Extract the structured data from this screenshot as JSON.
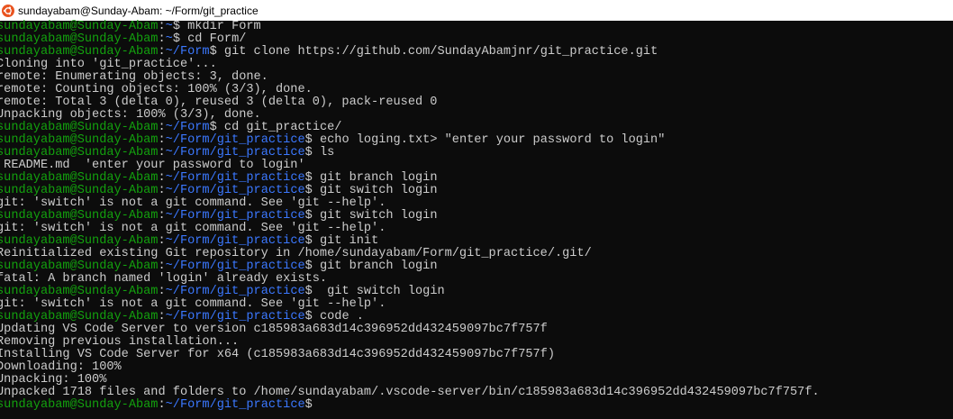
{
  "titlebar": {
    "title": "sundayabam@Sunday-Abam: ~/Form/git_practice",
    "icon": "ubuntu-icon"
  },
  "colors": {
    "background": "#0c0c0c",
    "prompt_user": "#13a10e",
    "prompt_path": "#3b78ff",
    "text": "#cccccc"
  },
  "terminal": {
    "lines": [
      {
        "type": "prompt",
        "user": "sundayabam@Sunday-Abam",
        "path": "~",
        "cmd": " mkdir Form"
      },
      {
        "type": "prompt",
        "user": "sundayabam@Sunday-Abam",
        "path": "~",
        "cmd": " cd Form/"
      },
      {
        "type": "prompt",
        "user": "sundayabam@Sunday-Abam",
        "path": "~/Form",
        "cmd": " git clone https://github.com/SundayAbamjnr/git_practice.git"
      },
      {
        "type": "output",
        "text": "Cloning into 'git_practice'..."
      },
      {
        "type": "output",
        "text": "remote: Enumerating objects: 3, done."
      },
      {
        "type": "output",
        "text": "remote: Counting objects: 100% (3/3), done."
      },
      {
        "type": "output",
        "text": "remote: Total 3 (delta 0), reused 3 (delta 0), pack-reused 0"
      },
      {
        "type": "output",
        "text": "Unpacking objects: 100% (3/3), done."
      },
      {
        "type": "prompt",
        "user": "sundayabam@Sunday-Abam",
        "path": "~/Form",
        "cmd": " cd git_practice/"
      },
      {
        "type": "prompt",
        "user": "sundayabam@Sunday-Abam",
        "path": "~/Form/git_practice",
        "cmd": " echo loging.txt> \"enter your password to login\""
      },
      {
        "type": "prompt",
        "user": "sundayabam@Sunday-Abam",
        "path": "~/Form/git_practice",
        "cmd": " ls"
      },
      {
        "type": "output",
        "text": " README.md  'enter your password to login'"
      },
      {
        "type": "prompt",
        "user": "sundayabam@Sunday-Abam",
        "path": "~/Form/git_practice",
        "cmd": " git branch login"
      },
      {
        "type": "prompt",
        "user": "sundayabam@Sunday-Abam",
        "path": "~/Form/git_practice",
        "cmd": " git switch login"
      },
      {
        "type": "output",
        "text": "git: 'switch' is not a git command. See 'git --help'."
      },
      {
        "type": "prompt",
        "user": "sundayabam@Sunday-Abam",
        "path": "~/Form/git_practice",
        "cmd": " git switch login"
      },
      {
        "type": "output",
        "text": "git: 'switch' is not a git command. See 'git --help'."
      },
      {
        "type": "prompt",
        "user": "sundayabam@Sunday-Abam",
        "path": "~/Form/git_practice",
        "cmd": " git init"
      },
      {
        "type": "output",
        "text": "Reinitialized existing Git repository in /home/sundayabam/Form/git_practice/.git/"
      },
      {
        "type": "prompt",
        "user": "sundayabam@Sunday-Abam",
        "path": "~/Form/git_practice",
        "cmd": " git branch login"
      },
      {
        "type": "output",
        "text": "fatal: A branch named 'login' already exists."
      },
      {
        "type": "prompt",
        "user": "sundayabam@Sunday-Abam",
        "path": "~/Form/git_practice",
        "cmd": "  git switch login"
      },
      {
        "type": "output",
        "text": "git: 'switch' is not a git command. See 'git --help'."
      },
      {
        "type": "prompt",
        "user": "sundayabam@Sunday-Abam",
        "path": "~/Form/git_practice",
        "cmd": " code ."
      },
      {
        "type": "output",
        "text": "Updating VS Code Server to version c185983a683d14c396952dd432459097bc7f757f"
      },
      {
        "type": "output",
        "text": "Removing previous installation..."
      },
      {
        "type": "output",
        "text": "Installing VS Code Server for x64 (c185983a683d14c396952dd432459097bc7f757f)"
      },
      {
        "type": "output",
        "text": "Downloading: 100%"
      },
      {
        "type": "output",
        "text": "Unpacking: 100%"
      },
      {
        "type": "output",
        "text": "Unpacked 1718 files and folders to /home/sundayabam/.vscode-server/bin/c185983a683d14c396952dd432459097bc7f757f."
      },
      {
        "type": "prompt",
        "user": "sundayabam@Sunday-Abam",
        "path": "~/Form/git_practice",
        "cmd": ""
      }
    ]
  }
}
